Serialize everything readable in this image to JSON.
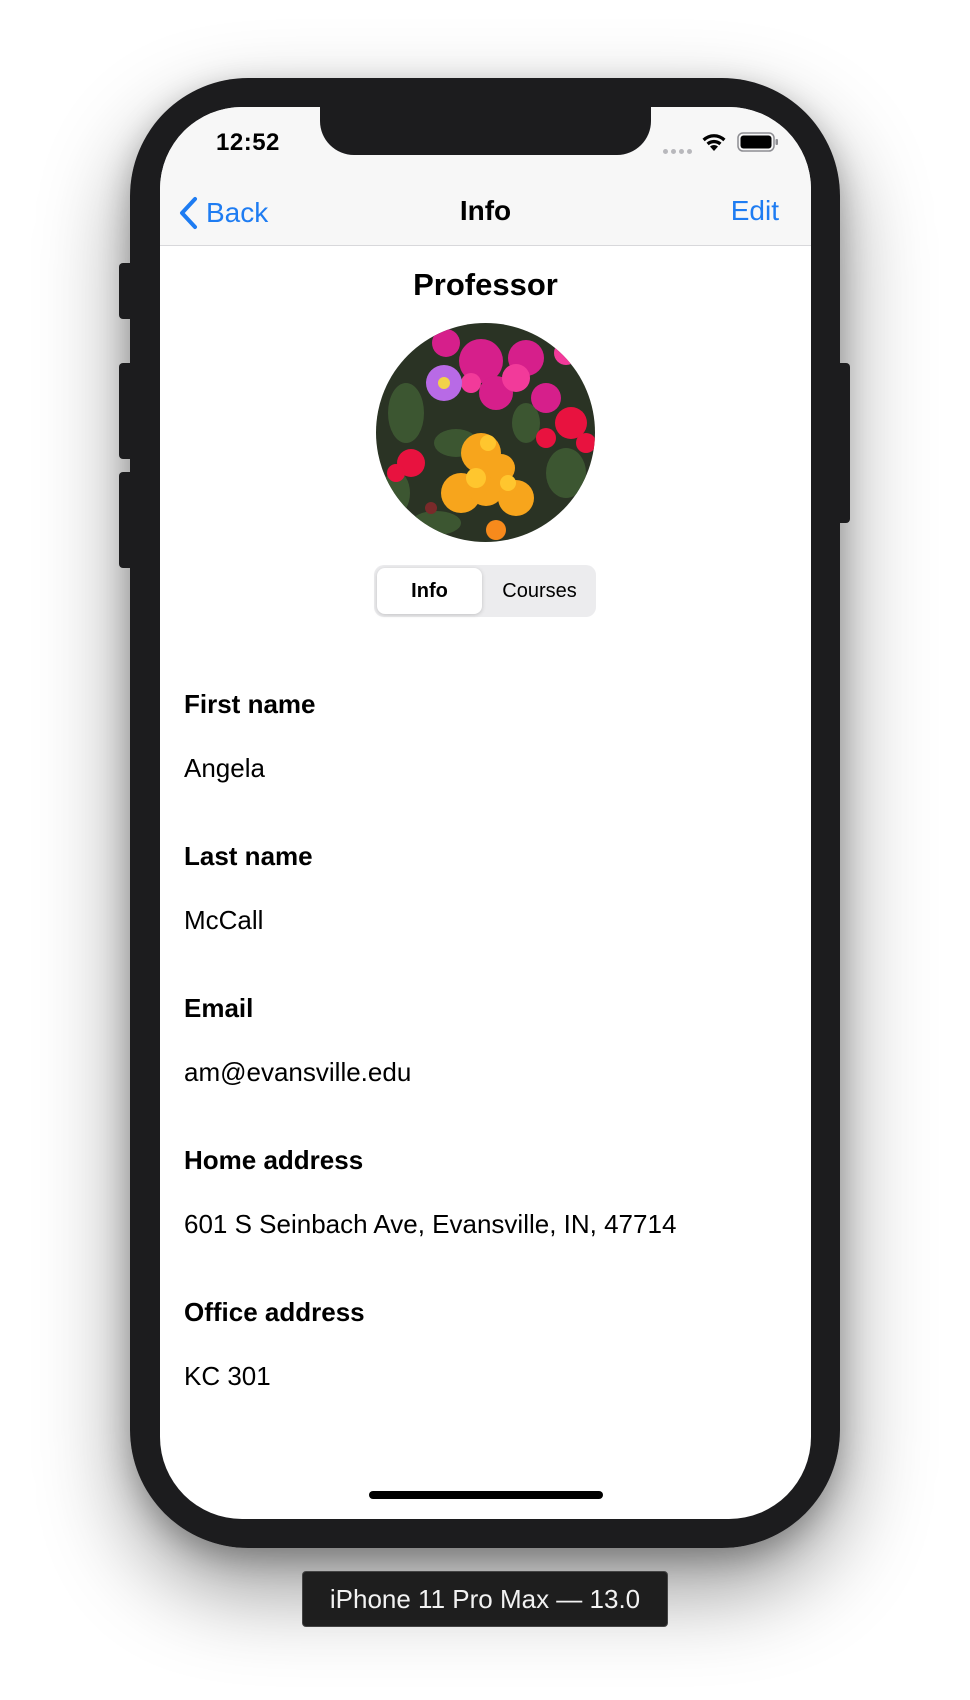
{
  "status_bar": {
    "time": "12:52"
  },
  "nav": {
    "back_label": "Back",
    "title": "Info",
    "edit_label": "Edit"
  },
  "header": {
    "role": "Professor"
  },
  "segmented": {
    "options": [
      "Info",
      "Courses"
    ],
    "selected": "Info"
  },
  "fields": [
    {
      "label": "First name",
      "value": "Angela"
    },
    {
      "label": "Last name",
      "value": "McCall"
    },
    {
      "label": "Email",
      "value": "am@evansville.edu"
    },
    {
      "label": "Home address",
      "value": "601 S Seinbach Ave, Evansville, IN, 47714"
    },
    {
      "label": "Office address",
      "value": "KC 301"
    }
  ],
  "device_label": "iPhone 11 Pro Max — 13.0",
  "colors": {
    "accent": "#1e7cf2",
    "frame": "#1c1c1e",
    "navbar": "#f7f7f7"
  },
  "icons": [
    "chevron-left-icon",
    "wifi-icon",
    "battery-icon",
    "signal-dots-icon"
  ]
}
